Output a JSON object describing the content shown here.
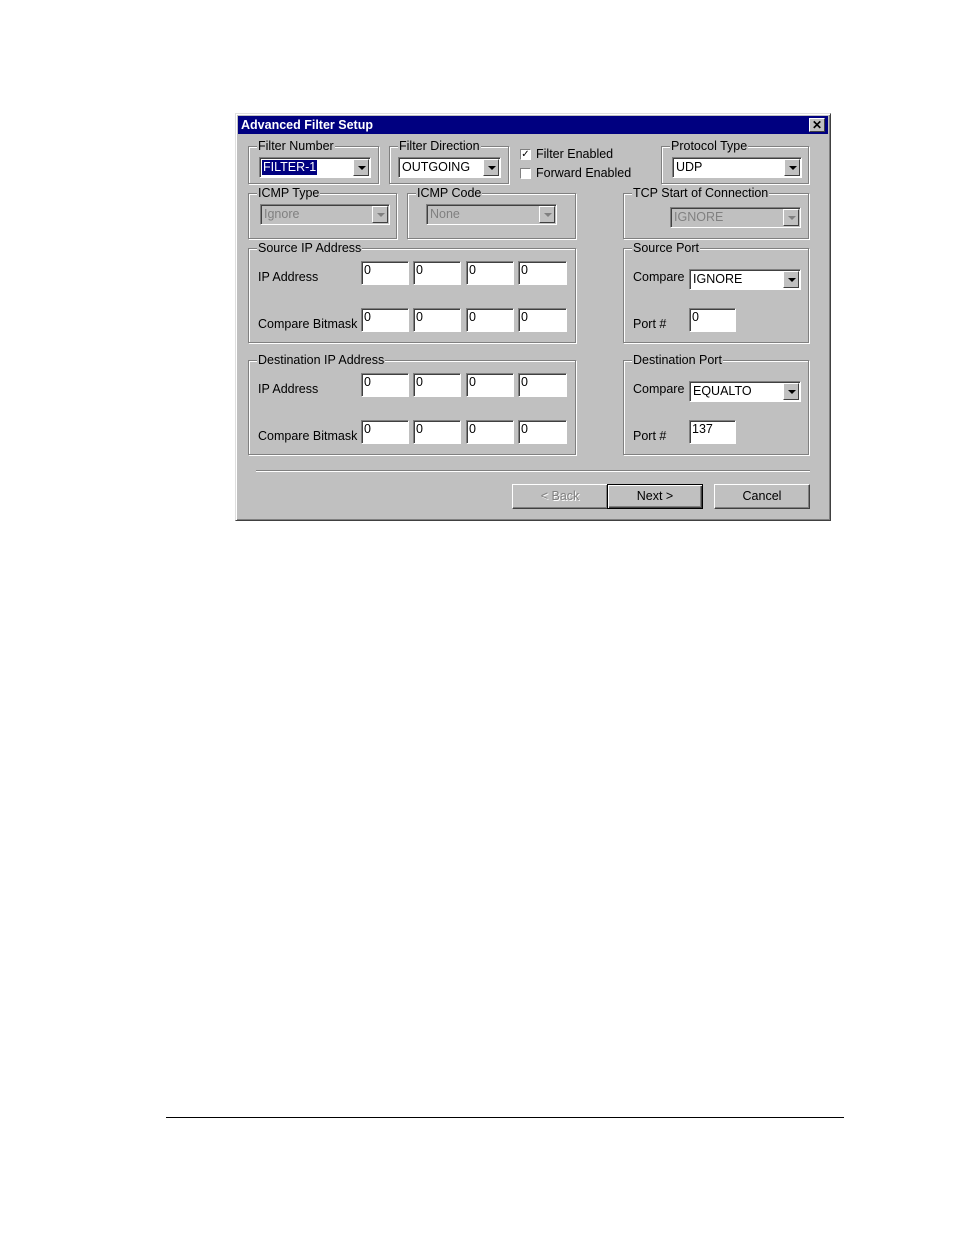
{
  "dialog": {
    "title": "Advanced Filter Setup",
    "close_glyph": "✕"
  },
  "filter_number": {
    "legend": "Filter Number",
    "value": "FILTER-1"
  },
  "filter_direction": {
    "legend": "Filter Direction",
    "value": "OUTGOING"
  },
  "filter_enabled": {
    "label": "Filter Enabled",
    "checked": true,
    "mark": "✓"
  },
  "forward_enabled": {
    "label": "Forward Enabled",
    "checked": false
  },
  "protocol_type": {
    "legend": "Protocol Type",
    "value": "UDP"
  },
  "icmp_type": {
    "legend": "ICMP Type",
    "value": "Ignore"
  },
  "icmp_code": {
    "legend": "ICMP Code",
    "value": "None"
  },
  "tcp_start": {
    "legend": "TCP Start of Connection",
    "value": "IGNORE"
  },
  "source_ip": {
    "legend": "Source IP Address",
    "ip_label": "IP Address",
    "mask_label": "Compare Bitmask",
    "ip": [
      "0",
      "0",
      "0",
      "0"
    ],
    "mask": [
      "0",
      "0",
      "0",
      "0"
    ]
  },
  "source_port": {
    "legend": "Source Port",
    "compare_label": "Compare",
    "compare_value": "IGNORE",
    "port_label": "Port #",
    "port_value": "0"
  },
  "dest_ip": {
    "legend": "Destination IP Address",
    "ip_label": "IP Address",
    "mask_label": "Compare Bitmask",
    "ip": [
      "0",
      "0",
      "0",
      "0"
    ],
    "mask": [
      "0",
      "0",
      "0",
      "0"
    ]
  },
  "dest_port": {
    "legend": "Destination Port",
    "compare_label": "Compare",
    "compare_value": "EQUALTO",
    "port_label": "Port #",
    "port_value": "137"
  },
  "buttons": {
    "back": "< Back",
    "next": "Next >",
    "cancel": "Cancel"
  }
}
